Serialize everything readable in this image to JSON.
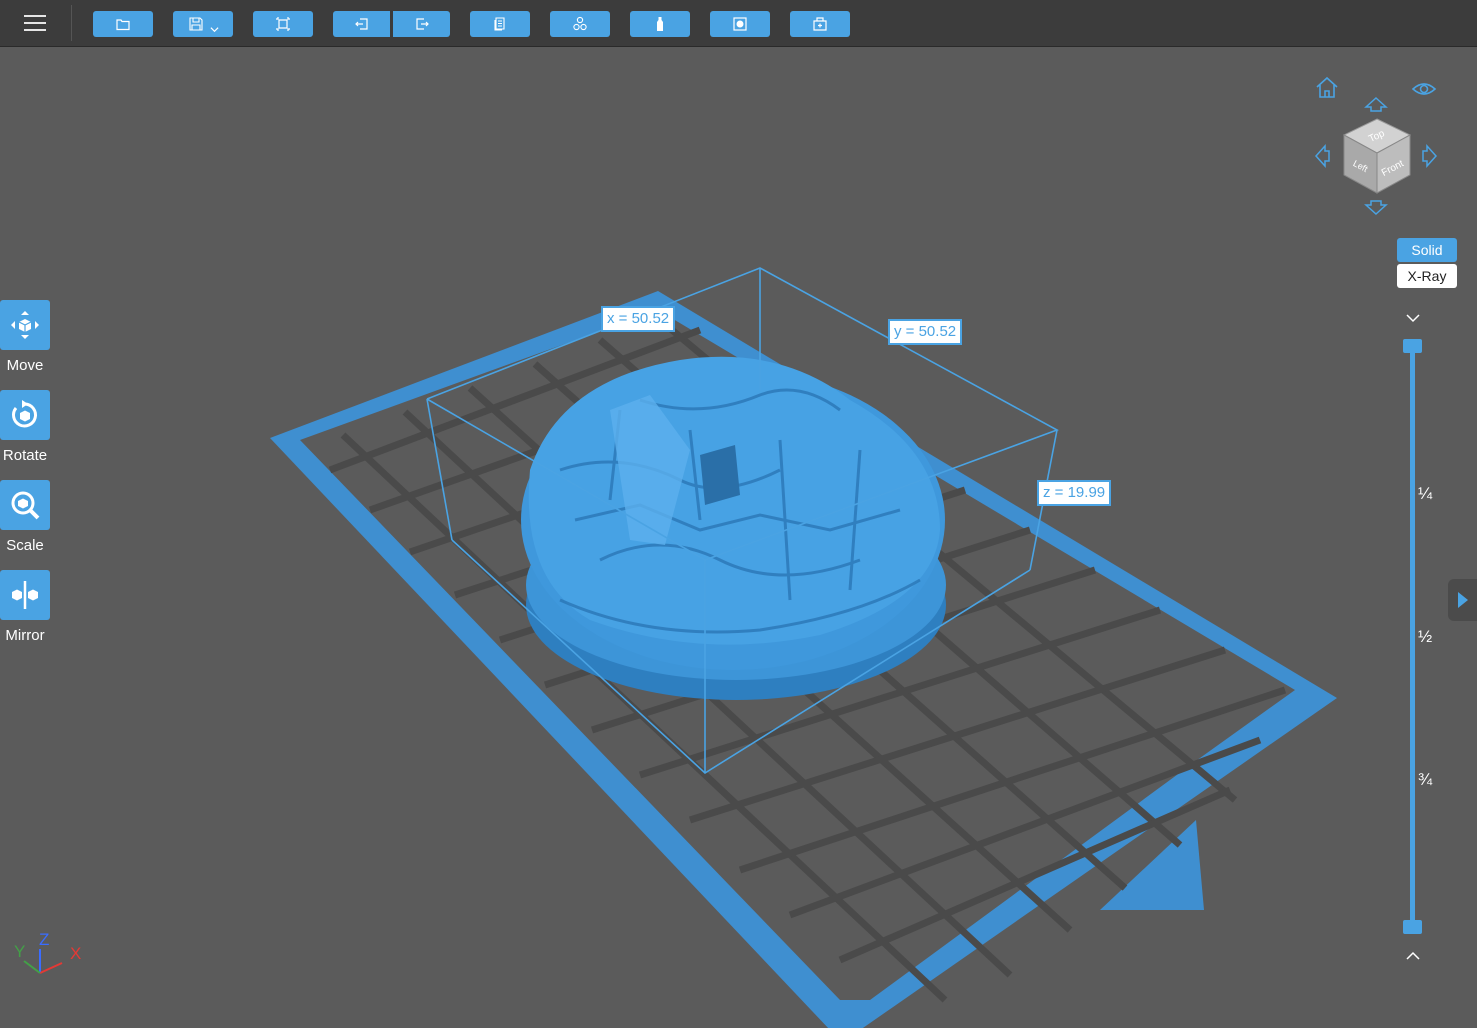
{
  "toolbar": {
    "buttons": [
      {
        "name": "open-file-button",
        "icon": "folder-icon"
      },
      {
        "name": "save-button",
        "icon": "save-icon"
      },
      {
        "name": "fit-view-button",
        "icon": "frame-icon"
      },
      {
        "name": "undo-button",
        "icon": "undo-icon"
      },
      {
        "name": "redo-button",
        "icon": "redo-icon"
      },
      {
        "name": "copy-button",
        "icon": "copy-icon"
      },
      {
        "name": "arrange-button",
        "icon": "arrange-icon"
      },
      {
        "name": "support-button",
        "icon": "bottle-icon"
      },
      {
        "name": "hollow-button",
        "icon": "hollow-icon"
      },
      {
        "name": "add-hole-button",
        "icon": "box-plus-icon"
      }
    ]
  },
  "dimensions": {
    "x_label": "x = 50.52",
    "y_label": "y = 50.52",
    "z_label": "z = 19.99"
  },
  "side_tools": [
    {
      "label": "Move",
      "icon": "move-icon"
    },
    {
      "label": "Rotate",
      "icon": "rotate-icon"
    },
    {
      "label": "Scale",
      "icon": "scale-icon"
    },
    {
      "label": "Mirror",
      "icon": "mirror-icon"
    }
  ],
  "view_cube": {
    "top": "Top",
    "front": "Front",
    "left": "Left"
  },
  "view_modes": {
    "solid": "Solid",
    "xray": "X-Ray",
    "active": "Solid"
  },
  "slider": {
    "ticks": [
      "¼",
      "½",
      "¾"
    ],
    "range": [
      0,
      1
    ]
  },
  "axes": {
    "x": "X",
    "y": "Y",
    "z": "Z"
  },
  "colors": {
    "accent": "#4aa3e3",
    "background": "#5b5b5b",
    "toolbar": "#3c3c3c",
    "model": "#3d95d8"
  }
}
